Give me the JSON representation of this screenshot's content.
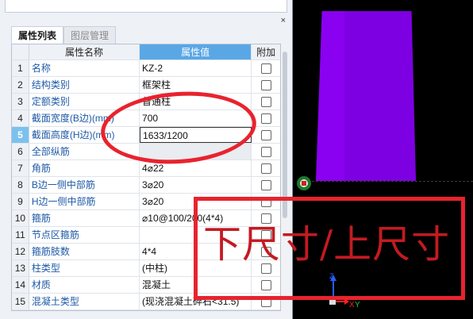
{
  "panel": {
    "close_glyph": "×",
    "tabs": [
      {
        "label": "属性列表",
        "active": true
      },
      {
        "label": "图层管理",
        "active": false
      }
    ],
    "columns": {
      "num": "",
      "name": "属性名称",
      "value": "属性值",
      "attach": "附加"
    },
    "rows": [
      {
        "num": "1",
        "name": "名称",
        "value": "KZ-2"
      },
      {
        "num": "2",
        "name": "结构类别",
        "value": "框架柱"
      },
      {
        "num": "3",
        "name": "定额类别",
        "value": "普通柱"
      },
      {
        "num": "4",
        "name": "截面宽度(B边)(mm)",
        "value": "700"
      },
      {
        "num": "5",
        "name": "截面高度(H边)(mm)",
        "value": "1633/1200"
      },
      {
        "num": "6",
        "name": "全部纵筋",
        "value": ""
      },
      {
        "num": "7",
        "name": "角筋",
        "value": "4⌀22"
      },
      {
        "num": "8",
        "name": "B边一侧中部筋",
        "value": "3⌀20"
      },
      {
        "num": "9",
        "name": "H边一侧中部筋",
        "value": "3⌀20"
      },
      {
        "num": "10",
        "name": "箍筋",
        "value": "⌀10@100/200(4*4)"
      },
      {
        "num": "11",
        "name": "节点区箍筋",
        "value": ""
      },
      {
        "num": "12",
        "name": "箍筋肢数",
        "value": "4*4"
      },
      {
        "num": "13",
        "name": "柱类型",
        "value": "(中柱)"
      },
      {
        "num": "14",
        "name": "材质",
        "value": "混凝土"
      },
      {
        "num": "15",
        "name": "混凝土类型",
        "value": "(现浇混凝土碎石<31.5)"
      }
    ],
    "selected_row": 5
  },
  "viewport": {
    "column_color": "#8a00f0",
    "axis_labels": {
      "z": "Z",
      "x": "X",
      "y": "Y"
    }
  },
  "annotation": {
    "text": "下尺寸/上尺寸",
    "color": "#e8232e"
  }
}
